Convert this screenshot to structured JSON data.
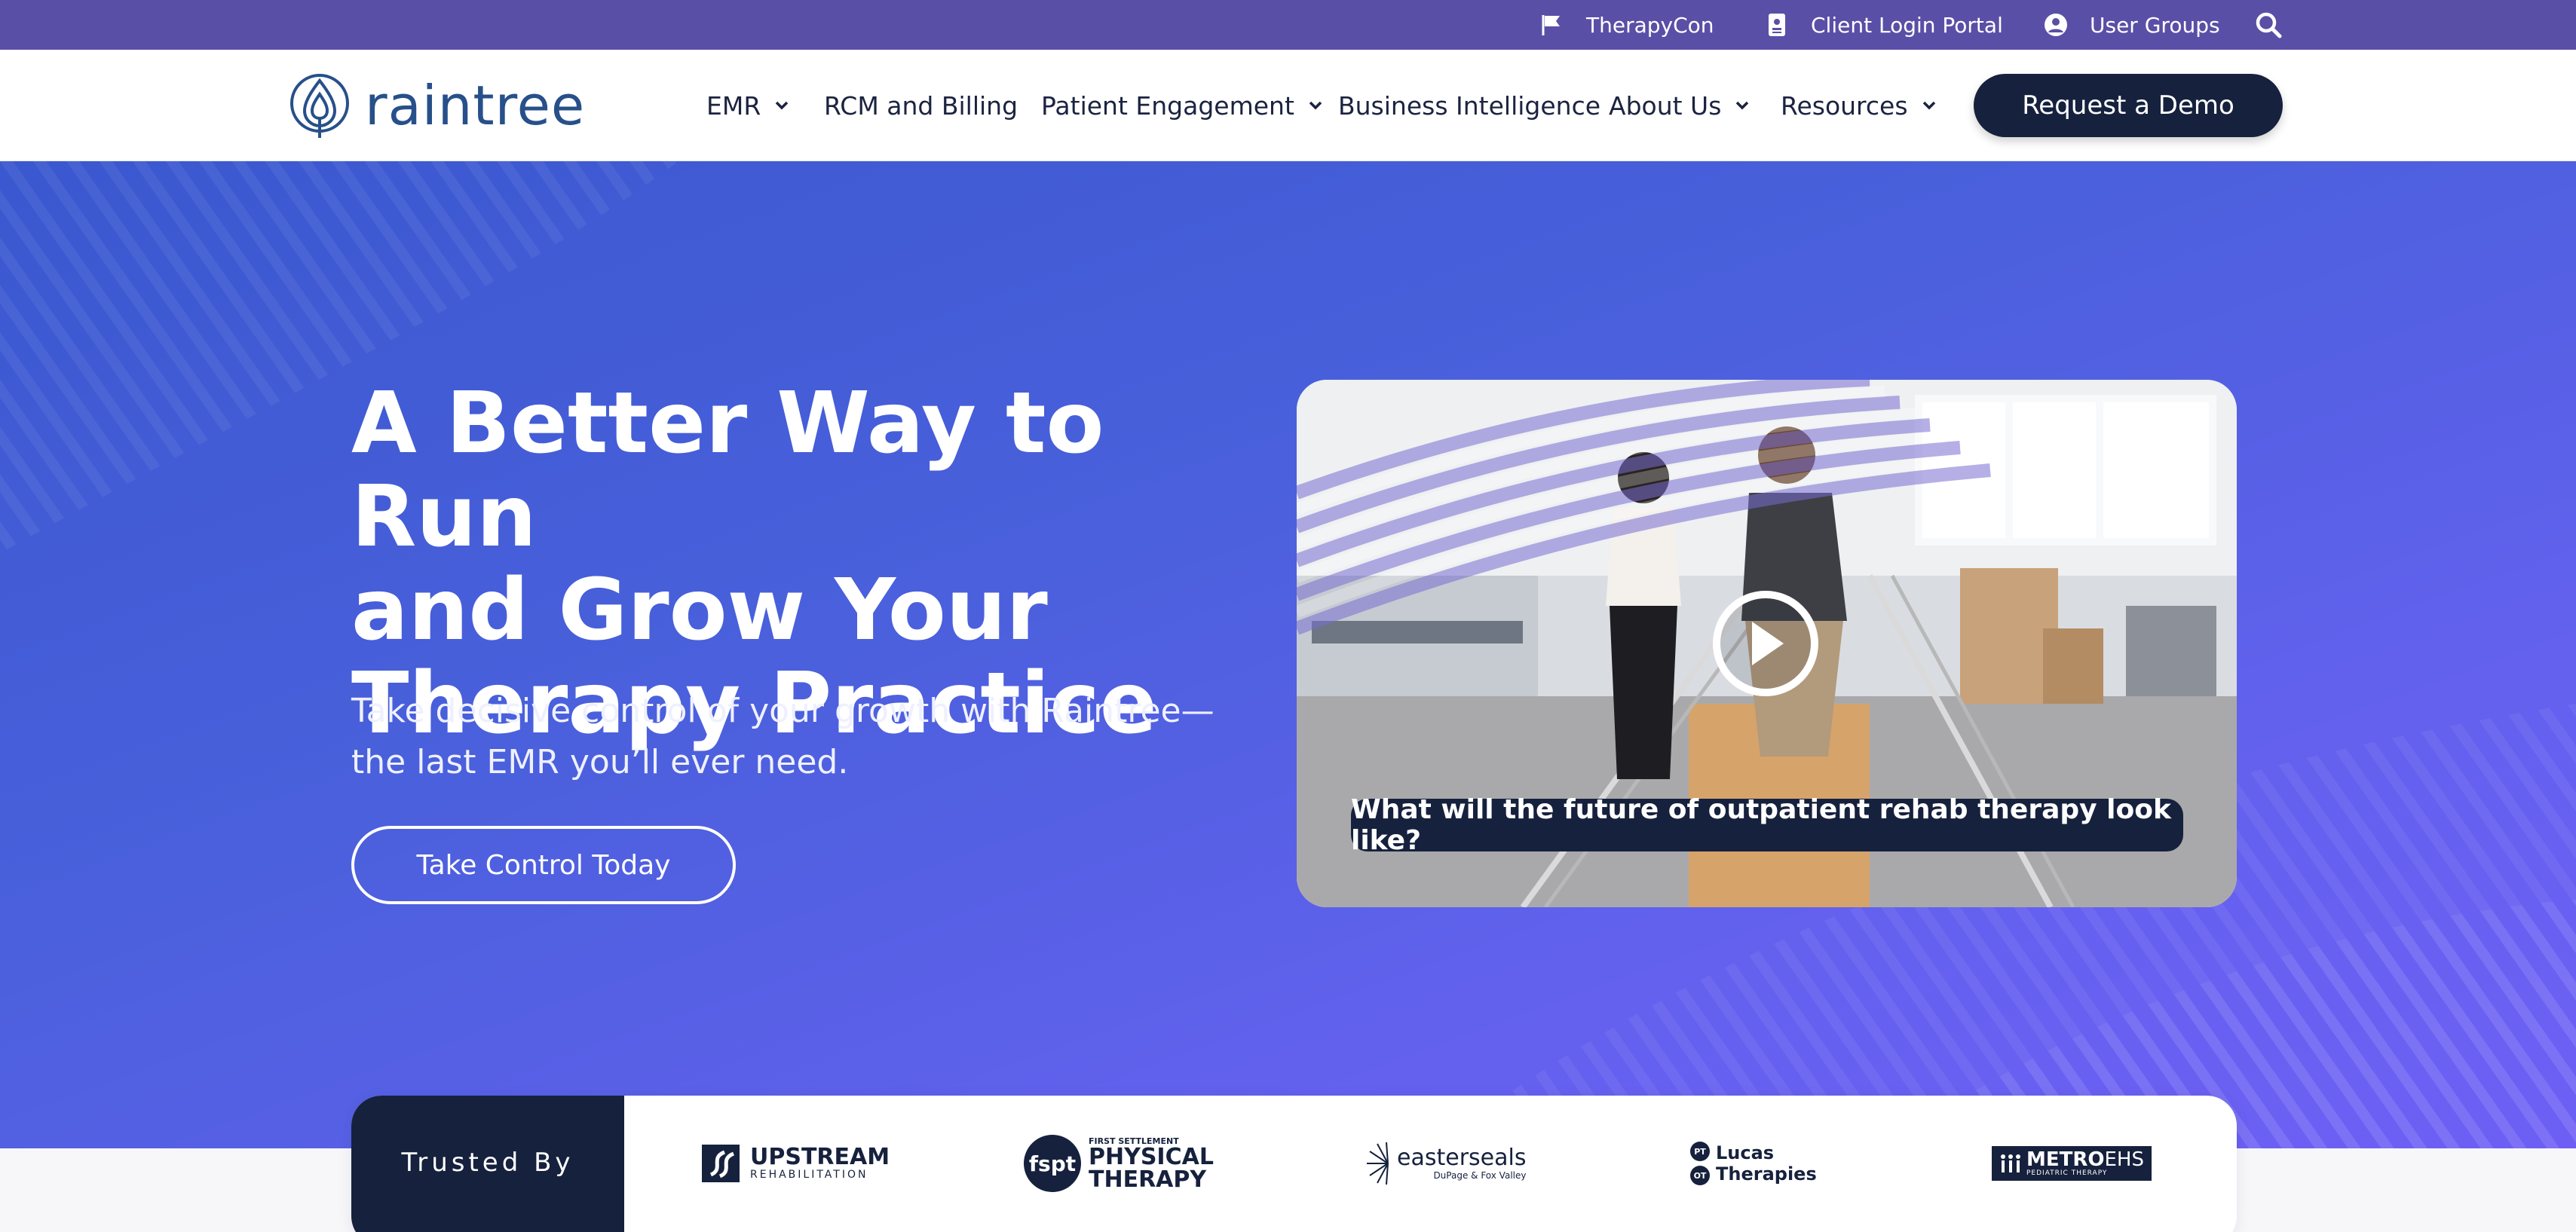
{
  "utility_bar": {
    "therapycon": "TherapyCon",
    "client_portal": "Client Login Portal",
    "user_groups": "User Groups"
  },
  "brand": {
    "name": "raintree",
    "color": "#27508a"
  },
  "nav": {
    "items": [
      {
        "label": "EMR",
        "has_dropdown": true
      },
      {
        "label": "RCM and Billing",
        "has_dropdown": false
      },
      {
        "label": "Patient Engagement",
        "has_dropdown": true
      },
      {
        "label": "Business Intelligence",
        "has_dropdown": false
      },
      {
        "label": "About Us",
        "has_dropdown": true
      },
      {
        "label": "Resources",
        "has_dropdown": true
      }
    ],
    "cta": "Request a Demo"
  },
  "hero": {
    "title_lines": [
      "A Better Way to Run",
      "and Grow Your",
      "Therapy Practice"
    ],
    "subtitle_lines": [
      "Take decisive control of your growth with Raintree—",
      "the last EMR you’ll ever need."
    ],
    "cta": "Take Control Today",
    "video_caption": "What will the future of outpatient rehab therapy look like?"
  },
  "trusted": {
    "label": "Trusted By",
    "logos": [
      {
        "name": "upstream-logo",
        "line1": "UPSTREAM",
        "line2": "REHABILITATION"
      },
      {
        "name": "fspt-logo",
        "mark": "fspt",
        "line1": "FIRST SETTLEMENT",
        "line2": "PHYSICAL",
        "line3": "THERAPY"
      },
      {
        "name": "easterseals-logo",
        "line1": "easterseals",
        "line2": "DuPage & Fox Valley"
      },
      {
        "name": "lucas-logo",
        "line1": "Lucas",
        "line2": "Therapies",
        "badge1": "PT",
        "badge2": "OT"
      },
      {
        "name": "metroehs-logo",
        "line1": "METRO",
        "line2": "EHS",
        "line3": "PEDIATRIC THERAPY"
      }
    ]
  },
  "colors": {
    "utility_bar": "#5a4fa6",
    "navy": "#16213d",
    "hero_start": "#3a58cf",
    "hero_end": "#6d5ff4"
  }
}
